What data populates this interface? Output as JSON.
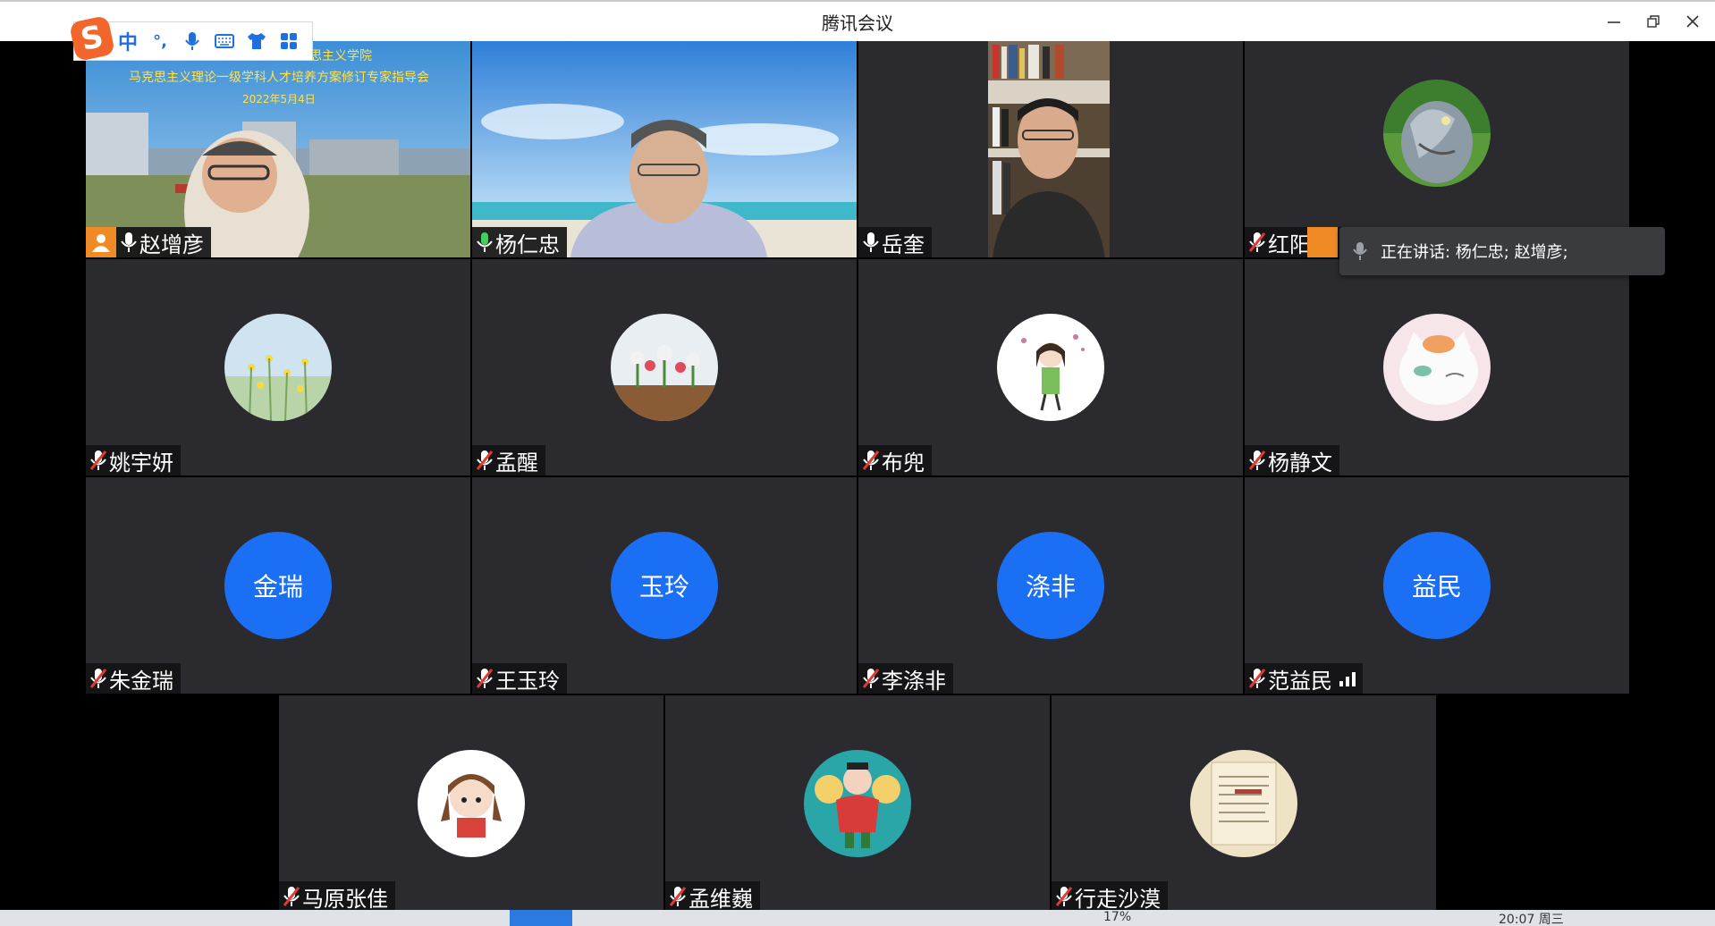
{
  "window": {
    "title": "腾讯会议"
  },
  "ime": {
    "mode_label": "中",
    "punct_label": "°,"
  },
  "tiles": [
    {
      "name": "赵增彦",
      "video": "slide",
      "slide": {
        "line1": "思主义学院",
        "line2": "马克思主义理论一级学科人才培养方案修订专家指导会",
        "line3": "2022年5月4日"
      },
      "mic": "on",
      "host": true
    },
    {
      "name": "杨仁忠",
      "video": "ocean",
      "mic": "on-green",
      "speaking": true
    },
    {
      "name": "岳奎",
      "video": "bookshelf",
      "mic": "on"
    },
    {
      "name": "红阳",
      "avatar": "bird",
      "mic": "muted",
      "signal": "orange"
    },
    {
      "name": "姚宇妍",
      "avatar": "flowers-field",
      "mic": "muted"
    },
    {
      "name": "孟醒",
      "avatar": "flowers-vase",
      "mic": "muted"
    },
    {
      "name": "布兜",
      "avatar": "cartoon-girl",
      "mic": "muted"
    },
    {
      "name": "杨静文",
      "avatar": "cat",
      "mic": "muted"
    },
    {
      "name": "朱金瑞",
      "avatar_text": "金瑞",
      "mic": "muted"
    },
    {
      "name": "王玉玲",
      "avatar_text": "玉玲",
      "mic": "muted"
    },
    {
      "name": "李涤非",
      "avatar_text": "涤非",
      "mic": "muted"
    },
    {
      "name": "范益民",
      "avatar_text": "益民",
      "mic": "muted",
      "signal": "white"
    },
    {
      "name": "马原张佳",
      "avatar": "doll",
      "mic": "muted"
    },
    {
      "name": "孟维巍",
      "avatar": "boy-fans",
      "mic": "muted"
    },
    {
      "name": "行走沙漠",
      "avatar": "document",
      "mic": "muted"
    }
  ],
  "speaking_banner": {
    "text": "正在讲话: 杨仁忠; 赵增彦;"
  },
  "taskbar": {
    "battery": "17%",
    "time": "20:07 周三"
  },
  "colors": {
    "avatar_blue": "#1a6ff5",
    "speaking_green": "#2aa44a",
    "host_orange": "#f08a25"
  }
}
